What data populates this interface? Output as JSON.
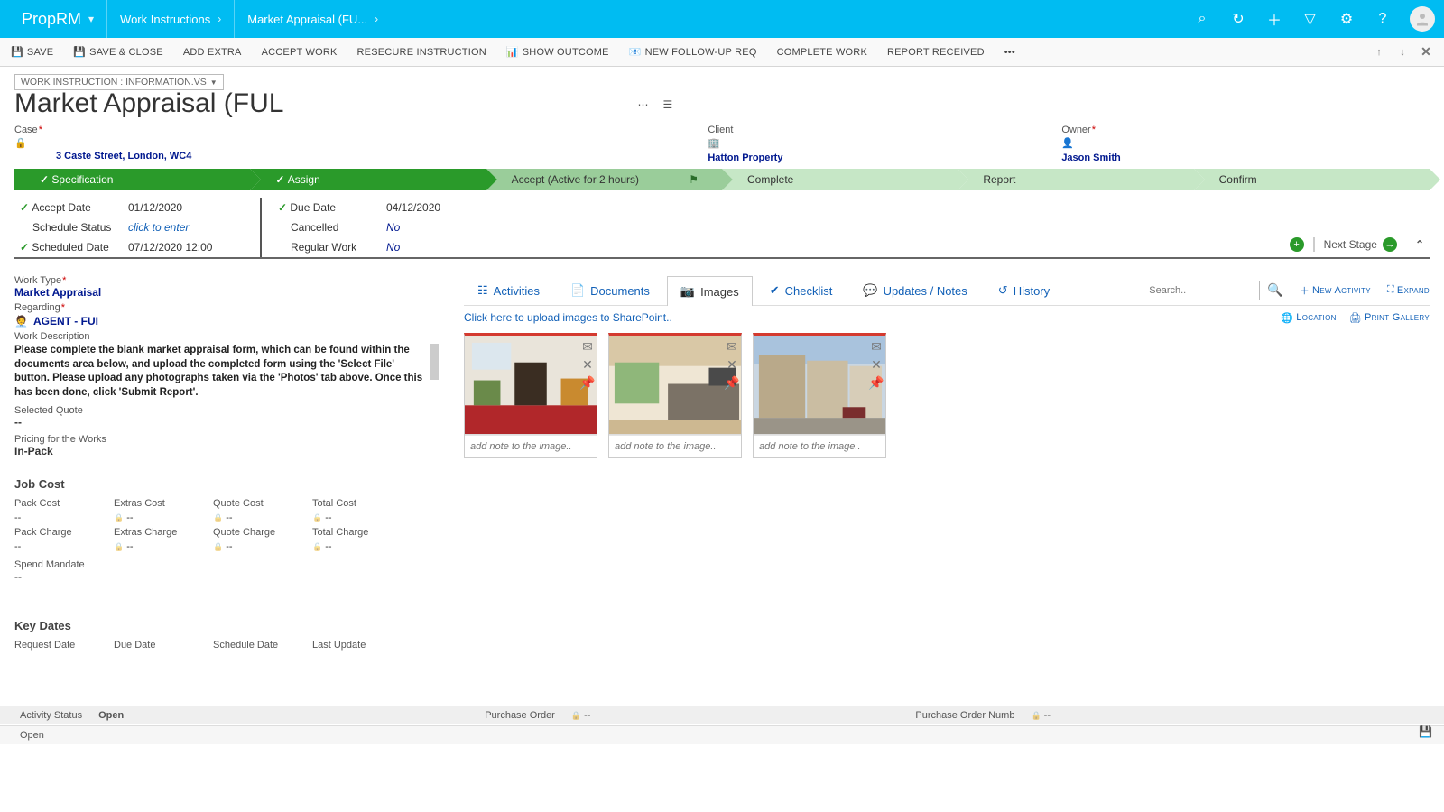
{
  "topbar": {
    "app": "PropRM",
    "crumbs": [
      "Work Instructions",
      "Market Appraisal (FU..."
    ]
  },
  "cmdbar": {
    "save": "SAVE",
    "saveclose": "SAVE & CLOSE",
    "addextra": "ADD EXTRA",
    "accept": "ACCEPT WORK",
    "resecure": "RESECURE INSTRUCTION",
    "showoutcome": "SHOW OUTCOME",
    "newfollowup": "NEW FOLLOW-UP REQ",
    "completework": "COMPLETE WORK",
    "reportreceived": "REPORT RECEIVED"
  },
  "header": {
    "formpill": "WORK INSTRUCTION : INFORMATION.VS",
    "title": "Market Appraisal (FUL",
    "case_label": "Case",
    "case_value": "3 Caste Street, London, WC4",
    "client_label": "Client",
    "client_value": "Hatton Property",
    "owner_label": "Owner",
    "owner_value": "Jason Smith"
  },
  "stages": {
    "spec": "Specification",
    "assign": "Assign",
    "accept": "Accept (Active for 2 hours)",
    "complete": "Complete",
    "report": "Report",
    "confirm": "Confirm"
  },
  "stagebody": {
    "accept_date_lbl": "Accept Date",
    "accept_date": "01/12/2020",
    "schedule_status_lbl": "Schedule Status",
    "schedule_status": "click to enter",
    "scheduled_date_lbl": "Scheduled Date",
    "scheduled_date": "07/12/2020  12:00",
    "due_date_lbl": "Due Date",
    "due_date": "04/12/2020",
    "cancelled_lbl": "Cancelled",
    "cancelled": "No",
    "regular_lbl": "Regular Work",
    "regular": "No",
    "next_stage": "Next Stage"
  },
  "left": {
    "worktype_lbl": "Work Type",
    "worktype": "Market Appraisal",
    "regarding_lbl": "Regarding",
    "regarding": "AGENT - FUI",
    "workdesc_lbl": "Work Description",
    "workdesc": "Please complete the blank market appraisal form, which can be found within the documents area below, and upload the completed form using the 'Select File' button. Please upload any photographs taken via the 'Photos' tab above. Once this has been done, click 'Submit Report'.",
    "selquote_lbl": "Selected Quote",
    "selquote": "--",
    "pricing_lbl": "Pricing for the Works",
    "pricing": "In-Pack",
    "jobcost_h": "Job Cost",
    "cost_labels": [
      "Pack Cost",
      "Extras Cost",
      "Quote Cost",
      "Total Cost",
      "Pack Charge",
      "Extras Charge",
      "Quote Charge",
      "Total Charge"
    ],
    "spend_lbl": "Spend Mandate",
    "spend": "--",
    "keydates_h": "Key Dates",
    "keydates": [
      "Request Date",
      "Due Date",
      "Schedule Date",
      "Last Update"
    ]
  },
  "tabs": {
    "activities": "Activities",
    "documents": "Documents",
    "images": "Images",
    "checklist": "Checklist",
    "updates": "Updates / Notes",
    "history": "History",
    "search_ph": "Search..",
    "new_activity": "New Activity",
    "expand": "Expand",
    "upload_hint": "Click here to upload images to SharePoint..",
    "location": "Location",
    "print": "Print Gallery",
    "img_note_ph": "add note to the image.."
  },
  "footer": {
    "activity_status_lbl": "Activity Status",
    "activity_status": "Open",
    "po_lbl": "Purchase Order",
    "po": "--",
    "ponum_lbl": "Purchase Order Numb",
    "ponum": "--",
    "open": "Open"
  }
}
